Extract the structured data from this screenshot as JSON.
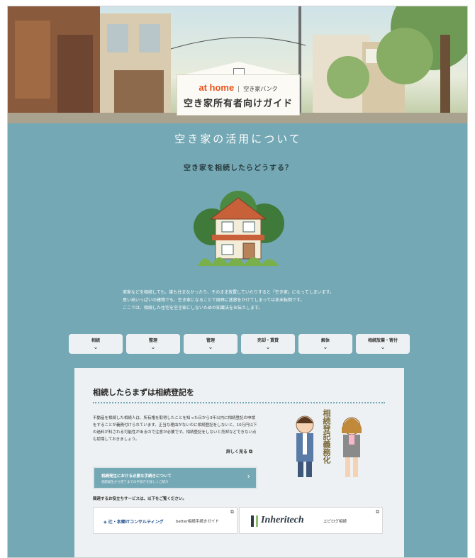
{
  "hero": {
    "brand": "at home",
    "bank": "空き家バンク",
    "guide_title": "空き家所有者向けガイド"
  },
  "section_title": "空き家の活用について",
  "subtitle": "空き家を相続したらどうする？",
  "intro": [
    "実家などを相続しても、誰も住まなかったり、そのまま放置していたりすると「空き家」になってしまいます。",
    "思い出いっぱいの建物でも、空き家になることで周囲に迷惑をかけてしまっては本末転倒です。",
    "ここでは、相続した住宅を空き家にしないための知識法をお伝えします。"
  ],
  "nav": [
    {
      "label": "相続"
    },
    {
      "label": "整理"
    },
    {
      "label": "管理"
    },
    {
      "label": "売却・賃貸"
    },
    {
      "label": "解体"
    },
    {
      "label": "相続放棄・寄付"
    }
  ],
  "card": {
    "title": "相続したらまずは相続登記を",
    "body": "不動産を相続した相続人は、所有権を取得したことを知った日から3年以内に相続登記の申請をすることが義務付けられています。正当な理由がないのに相続登記をしないと、10万円以下の過料が科される可能性があるので注意が必要です。相続登記をしないと売却などできない点も認識しておきましょう。",
    "more_label": "詳しく見る",
    "vertical_text": "相続登記義務化",
    "procedure_title": "相続発生における必要な手続きについて",
    "procedure_sub": "相続発生から完了までの手続きを詳しくご紹介",
    "related_label": "関連するお役立ちサービスは、以下をご覧ください。",
    "services": [
      {
        "name": "辻・本郷ITコンサルティング",
        "desc": "better相続手続きガイド"
      },
      {
        "name": "Inheritech",
        "desc": "エピログ相続"
      }
    ]
  }
}
